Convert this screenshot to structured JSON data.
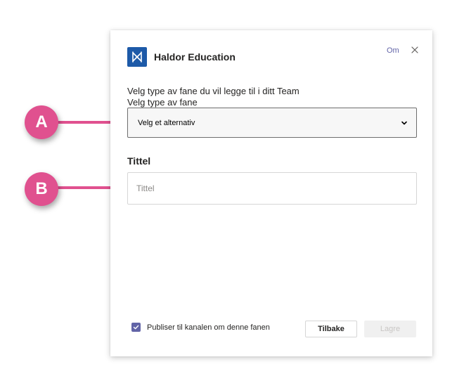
{
  "dialog": {
    "app_name": "Haldor Education",
    "about_link": "Om",
    "intro_text": "Velg type av fane du vil legge til i ditt Team",
    "select_label": "Velg type av fane",
    "select_value": "Velg et alternativ",
    "title_heading": "Tittel",
    "title_placeholder": "Tittel",
    "publish_checked": true,
    "publish_label": "Publiser til kanalen om denne fanen",
    "back_button": "Tilbake",
    "save_button": "Lagre"
  },
  "callouts": [
    {
      "label": "A"
    },
    {
      "label": "B"
    }
  ],
  "colors": {
    "accent": "#6264a7",
    "logo_bg": "#1d5aa8",
    "callout": "#e0518f"
  }
}
